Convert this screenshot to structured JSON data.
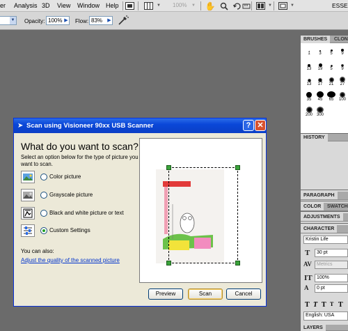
{
  "menubar": {
    "items": [
      "er",
      "Analysis",
      "3D",
      "View",
      "Window",
      "Help"
    ],
    "zoom": "100%",
    "workspace": "ESSE"
  },
  "options_bar": {
    "opacity_label": "Opacity:",
    "opacity_value": "100%",
    "flow_label": "Flow:",
    "flow_value": "83%"
  },
  "brushes_panel": {
    "tabs": [
      "BRUSHES",
      "CLONE"
    ],
    "sizes": [
      "1",
      "3",
      "5",
      "9",
      "13",
      "19",
      "5",
      "9",
      "13",
      "17",
      "21",
      "27",
      "35",
      "45",
      "65",
      "100",
      "200",
      "300"
    ]
  },
  "history_panel": {
    "tab": "HISTORY"
  },
  "paragraph_panel": {
    "tab": "PARAGRAPH"
  },
  "color_panel": {
    "tabs": [
      "COLOR",
      "SWATCH"
    ]
  },
  "adjustments_panel": {
    "tab": "ADJUSTMENTS"
  },
  "character_panel": {
    "tab": "CHARACTER",
    "font_family": "Kristin Life",
    "font_size": "30 pt",
    "kerning": "Metrics",
    "vertical_scale": "100%",
    "baseline_shift": "0 pt",
    "language": "English: USA"
  },
  "layers_panel": {
    "tab": "LAYERS"
  },
  "dialog": {
    "title": "Scan using Visioneer 90xx USB Scanner",
    "heading": "What do you want to scan?",
    "instruction": "Select an option below for the type of picture you want to scan.",
    "options": [
      {
        "label": "Color picture",
        "selected": false
      },
      {
        "label": "Grayscale picture",
        "selected": false
      },
      {
        "label": "Black and white picture or text",
        "selected": false
      },
      {
        "label": "Custom Settings",
        "selected": true
      }
    ],
    "also_label": "You can also:",
    "adjust_link": "Adjust the quality of the scanned picture",
    "buttons": {
      "preview": "Preview",
      "scan": "Scan",
      "cancel": "Cancel"
    }
  }
}
